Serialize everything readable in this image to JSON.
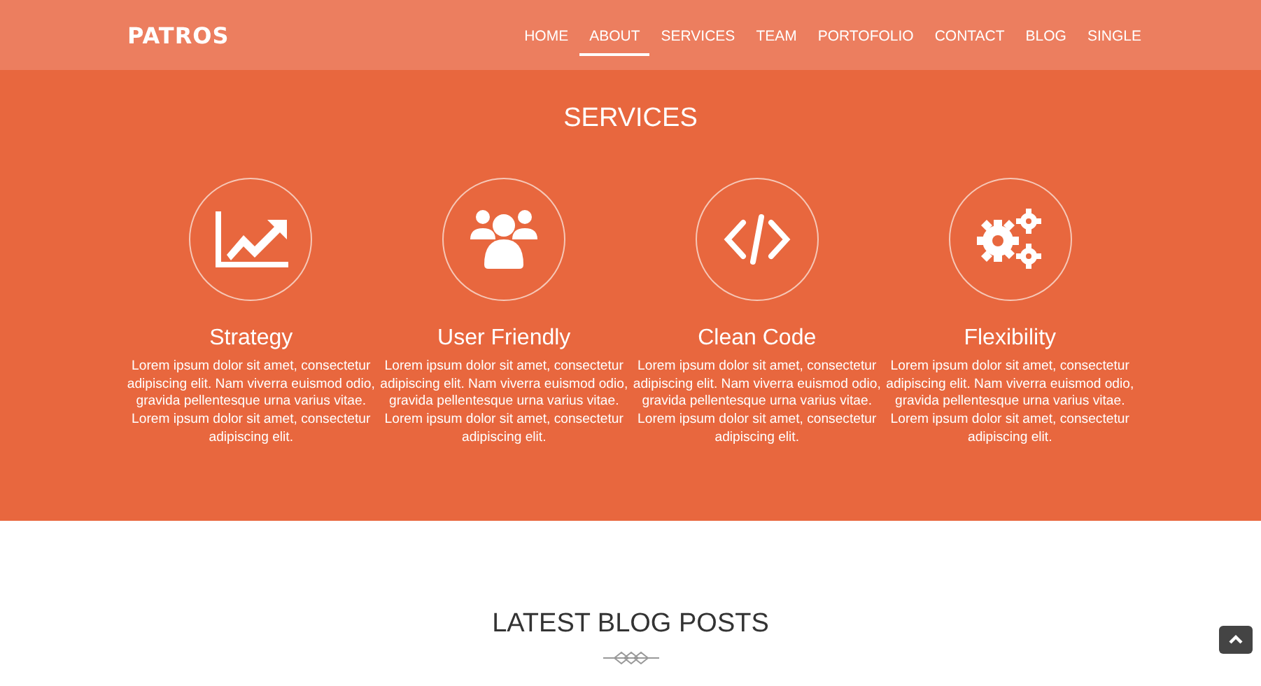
{
  "header": {
    "logo": "PATROS",
    "nav": [
      {
        "label": "HOME",
        "selected": false
      },
      {
        "label": "ABOUT",
        "selected": true
      },
      {
        "label": "SERVICES",
        "selected": false
      },
      {
        "label": "TEAM",
        "selected": false
      },
      {
        "label": "PORTOFOLIO",
        "selected": false
      },
      {
        "label": "CONTACT",
        "selected": false
      },
      {
        "label": "BLOG",
        "selected": false
      },
      {
        "label": "SINGLE",
        "selected": false
      }
    ]
  },
  "services": {
    "title": "SERVICES",
    "items": [
      {
        "kind": "chart",
        "title": "Strategy",
        "text": "Lorem ipsum dolor sit amet, consectetur adipiscing elit. Nam viverra euismod odio, gravida pellentesque urna varius vitae. Lorem ipsum dolor sit amet, consectetur adipiscing elit."
      },
      {
        "kind": "users",
        "title": "User Friendly",
        "text": "Lorem ipsum dolor sit amet, consectetur adipiscing elit. Nam viverra euismod odio, gravida pellentesque urna varius vitae. Lorem ipsum dolor sit amet, consectetur adipiscing elit."
      },
      {
        "kind": "code",
        "title": "Clean Code",
        "text": "Lorem ipsum dolor sit amet, consectetur adipiscing elit. Nam viverra euismod odio, gravida pellentesque urna varius vitae. Lorem ipsum dolor sit amet, consectetur adipiscing elit."
      },
      {
        "kind": "gears",
        "title": "Flexibility",
        "text": "Lorem ipsum dolor sit amet, consectetur adipiscing elit. Nam viverra euismod odio, gravida pellentesque urna varius vitae. Lorem ipsum dolor sit amet, consectetur adipiscing elit."
      }
    ]
  },
  "blog": {
    "title": "LATEST BLOG POSTS"
  }
}
